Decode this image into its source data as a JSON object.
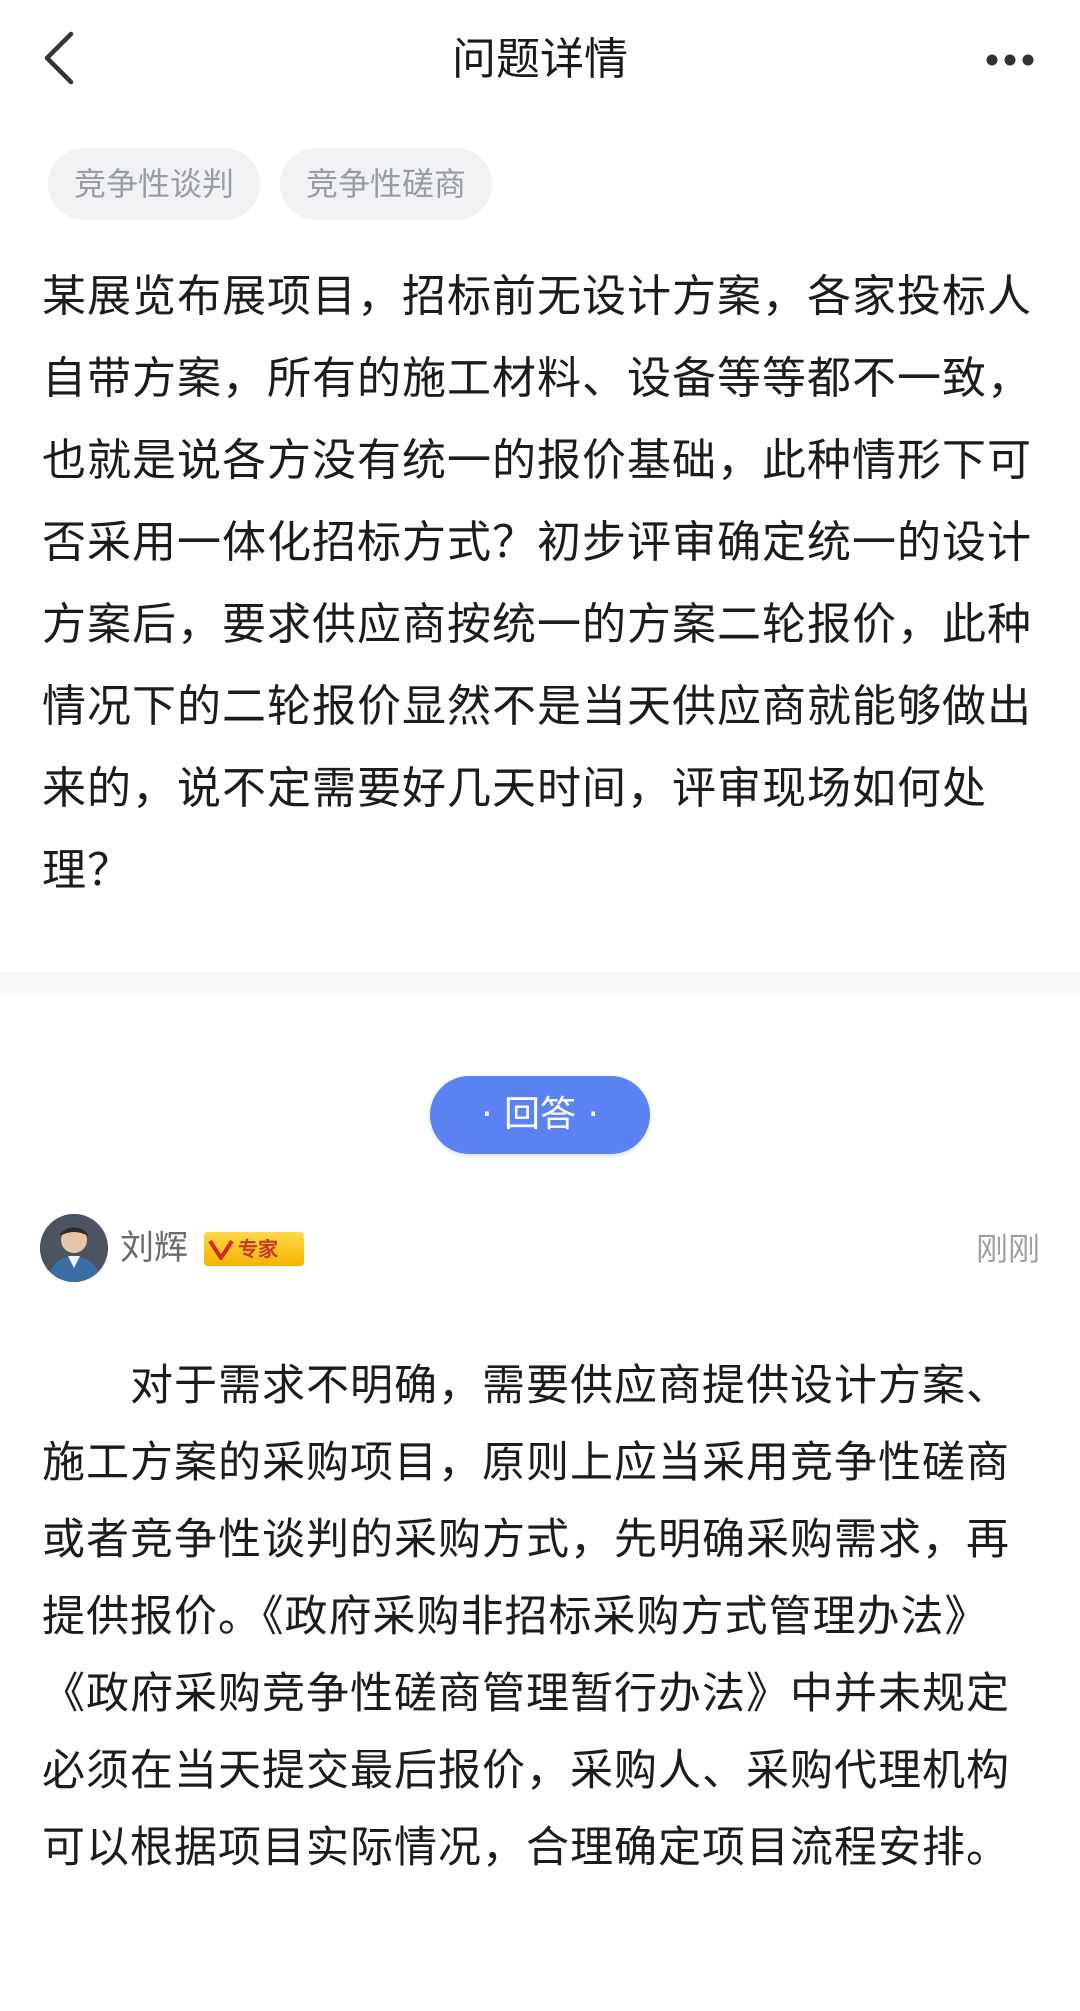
{
  "header": {
    "title": "问题详情",
    "back_icon": "chevron-left-icon",
    "more_icon": "more-horizontal-icon"
  },
  "tags": [
    "竞争性谈判",
    "竞争性磋商"
  ],
  "question": {
    "text": "某展览布展项目，招标前无设计方案，各家投标人自带方案，所有的施工材料、设备等等都不一致，也就是说各方没有统一的报价基础，此种情形下可否采用一体化招标方式？初步评审确定统一的设计方案后，要求供应商按统一的方案二轮报价，此种情况下的二轮报价显然不是当天供应商就能够做出来的，说不定需要好几天时间，评审现场如何处理？"
  },
  "answer_section": {
    "label": "· 回答 ·"
  },
  "answer": {
    "author": "刘辉",
    "badge": "专家",
    "timestamp": "刚刚",
    "text": "对于需求不明确，需要供应商提供设计方案、施工方案的采购项目，原则上应当采用竞争性磋商或者竞争性谈判的采购方式，先明确采购需求，再提供报价。《政府采购非招标采购方式管理办法》《政府采购竞争性磋商管理暂行办法》中并未规定必须在当天提交最后报价，采购人、采购代理机构可以根据项目实际情况，合理确定项目流程安排。"
  },
  "colors": {
    "accent": "#5b82f3",
    "tag_bg": "#f1f2f4",
    "tag_text": "#9a9ca3",
    "badge": "#f4b400"
  }
}
